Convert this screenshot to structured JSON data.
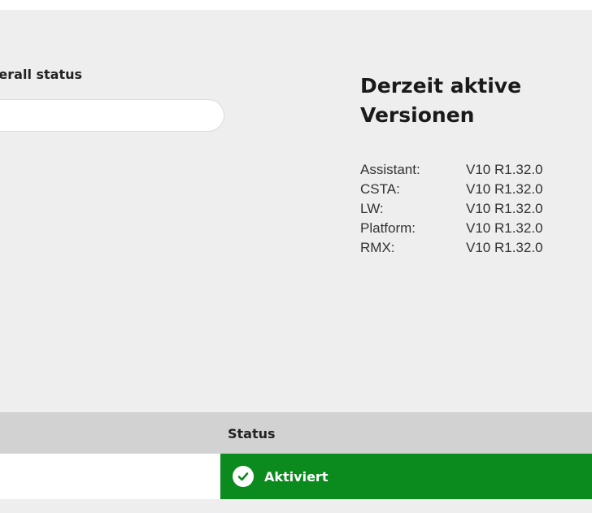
{
  "overall": {
    "label": "verall status"
  },
  "versions": {
    "title": "Derzeit aktive Versionen",
    "items": [
      {
        "name": "Assistant:",
        "value": "V10 R1.32.0"
      },
      {
        "name": "CSTA:",
        "value": "V10 R1.32.0"
      },
      {
        "name": "LW:",
        "value": "V10 R1.32.0"
      },
      {
        "name": "Platform:",
        "value": "V10 R1.32.0"
      },
      {
        "name": "RMX:",
        "value": "V10 R1.32.0"
      }
    ]
  },
  "table": {
    "header_status": "Status",
    "row_status": "Aktiviert",
    "status_color": "#0b8a1e",
    "status_icon": "check-circle-icon"
  }
}
